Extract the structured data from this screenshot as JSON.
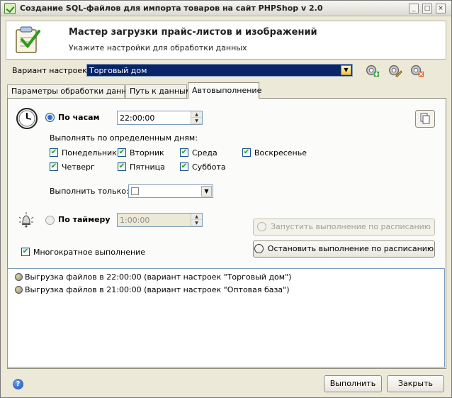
{
  "window": {
    "title": "Создание SQL-файлов для импорта товаров на сайт PHPShop v 2.0",
    "controls": {
      "minimize": "_",
      "maximize": "□",
      "close": "×"
    }
  },
  "header": {
    "title": "Мастер загрузки прайс-листов и изображений",
    "subtitle": "Укажите настройки для обработки данных",
    "icon": "clipboard-check-icon"
  },
  "settings": {
    "label": "Вариант настроек:",
    "value": "Торговый дом",
    "dropdown_glyph": "▼"
  },
  "tabs": [
    {
      "label": "Параметры обработки данных"
    },
    {
      "label": "Путь к данным"
    },
    {
      "label": "Автовыполнение",
      "active": true
    }
  ],
  "schedule": {
    "by_hours": {
      "label": "По часам",
      "selected": true,
      "time": "22:00:00"
    },
    "days_label": "Выполнять по определенным дням:",
    "days": [
      {
        "label": "Понедельник",
        "checked": true
      },
      {
        "label": "Вторник",
        "checked": true
      },
      {
        "label": "Среда",
        "checked": true
      },
      {
        "label": "Воскресенье",
        "checked": true
      },
      {
        "label": "Четверг",
        "checked": true
      },
      {
        "label": "Пятница",
        "checked": true
      },
      {
        "label": "Суббота",
        "checked": true
      }
    ],
    "only_label": "Выполнить только:",
    "by_timer": {
      "label": "По таймеру",
      "selected": false,
      "value": "1:00:00"
    },
    "multiple": {
      "label": "Многократное выполнение",
      "checked": true
    },
    "start_button": "Запустить выполнение по расписанию",
    "stop_button": "Остановить выполнение по расписанию",
    "check_glyph": "✔",
    "spin_up": "▲",
    "spin_down": "▼"
  },
  "log": [
    "Выгрузка файлов в 22:00:00 (вариант настроек \"Торговый дом\")",
    "Выгрузка файлов в 21:00:00 (вариант настроек \"Оптовая база\")"
  ],
  "footer": {
    "help": "?",
    "run_button": "Выполнить",
    "close_button": "Закрыть"
  }
}
